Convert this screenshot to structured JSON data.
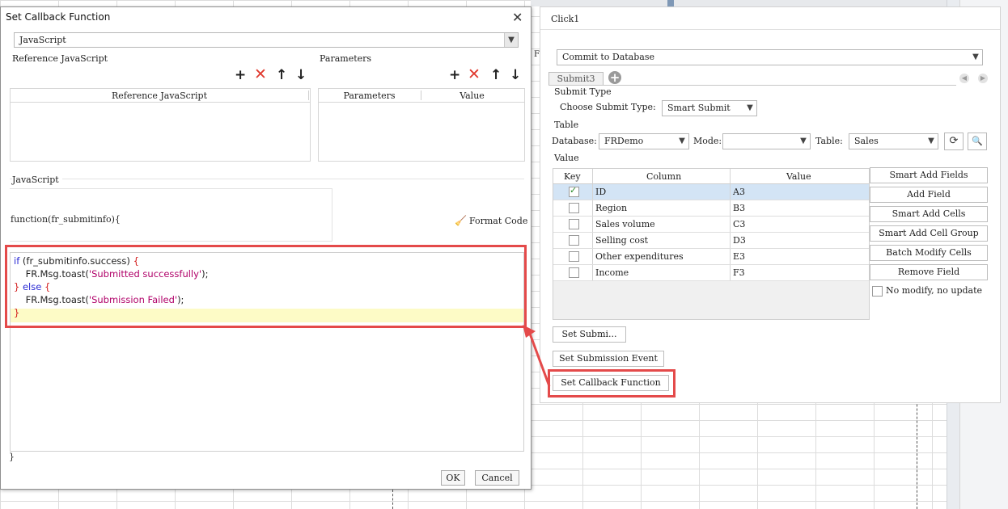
{
  "dialog": {
    "title": "Set Callback Function",
    "close_glyph": "✕",
    "language": "JavaScript",
    "reference_section_label": "Reference JavaScript",
    "reference_column": "Reference JavaScript",
    "parameters_section_label": "Parameters",
    "parameters_columns": [
      "Parameters",
      "Value"
    ],
    "toolbar_glyphs": {
      "add": "+",
      "delete": "✕",
      "up": "↑",
      "down": "↓"
    },
    "javascript_label": "JavaScript",
    "function_signature": "function(fr_submitinfo){",
    "format_code_label": "Format Code",
    "format_code_glyph": "🧹",
    "code": {
      "kw_if": "if",
      "cond": " (fr_submitinfo.success) ",
      "open1": "{",
      "toast1_prefix": "    FR.Msg.toast(",
      "toast1_str": "'Submitted successfully'",
      "toast1_suffix": ");",
      "close_else_open_a": "} ",
      "kw_else": "else",
      "close_else_open_b": " {",
      "toast2_prefix": "    FR.Msg.toast(",
      "toast2_str": "'Submission Failed'",
      "toast2_suffix": ");",
      "close_final": "}"
    },
    "closing_brace": "}",
    "ok_label": "OK",
    "cancel_label": "Cancel"
  },
  "right_panel": {
    "title": "Click1",
    "action_select": "Commit to Database",
    "tab_label": "Submit3",
    "tab_add_glyph": "+",
    "nav_prev": "◀",
    "nav_next": "▶",
    "submit_type_label": "Submit Type",
    "choose_submit_type_label": "Choose Submit Type:",
    "submit_type_value": "Smart Submit",
    "table_section_label": "Table",
    "database_label": "Database:",
    "database_value": "FRDemo",
    "mode_label": "Mode:",
    "mode_value": "",
    "table_label": "Table:",
    "table_value": "Sales",
    "refresh_glyph": "⟳",
    "preview_glyph": "🔍",
    "value_section_label": "Value",
    "value_columns": [
      "Key",
      "Column",
      "Value"
    ],
    "rows": [
      {
        "key": true,
        "column": "ID",
        "value": "A3"
      },
      {
        "key": false,
        "column": "Region",
        "value": "B3"
      },
      {
        "key": false,
        "column": "Sales volume",
        "value": "C3"
      },
      {
        "key": false,
        "column": "Selling cost",
        "value": "D3"
      },
      {
        "key": false,
        "column": "Other expenditures",
        "value": "E3"
      },
      {
        "key": false,
        "column": "Income",
        "value": "F3"
      }
    ],
    "side_buttons": [
      "Smart Add Fields",
      "Add Field",
      "Smart Add Cells",
      "Smart Add Cell Group",
      "Batch Modify Cells",
      "Remove Field"
    ],
    "no_modify_label": "No modify, no update",
    "set_submit_label": "Set Submi...",
    "set_submission_event_label": "Set Submission Event",
    "set_callback_label": "Set Callback Function"
  },
  "background": {
    "column_header_letter": "F"
  },
  "colors": {
    "highlight_red": "#e44a4a",
    "code_keyword": "#2a2ad4",
    "code_string": "#b00068",
    "selected_row": "#d3e4f5"
  }
}
